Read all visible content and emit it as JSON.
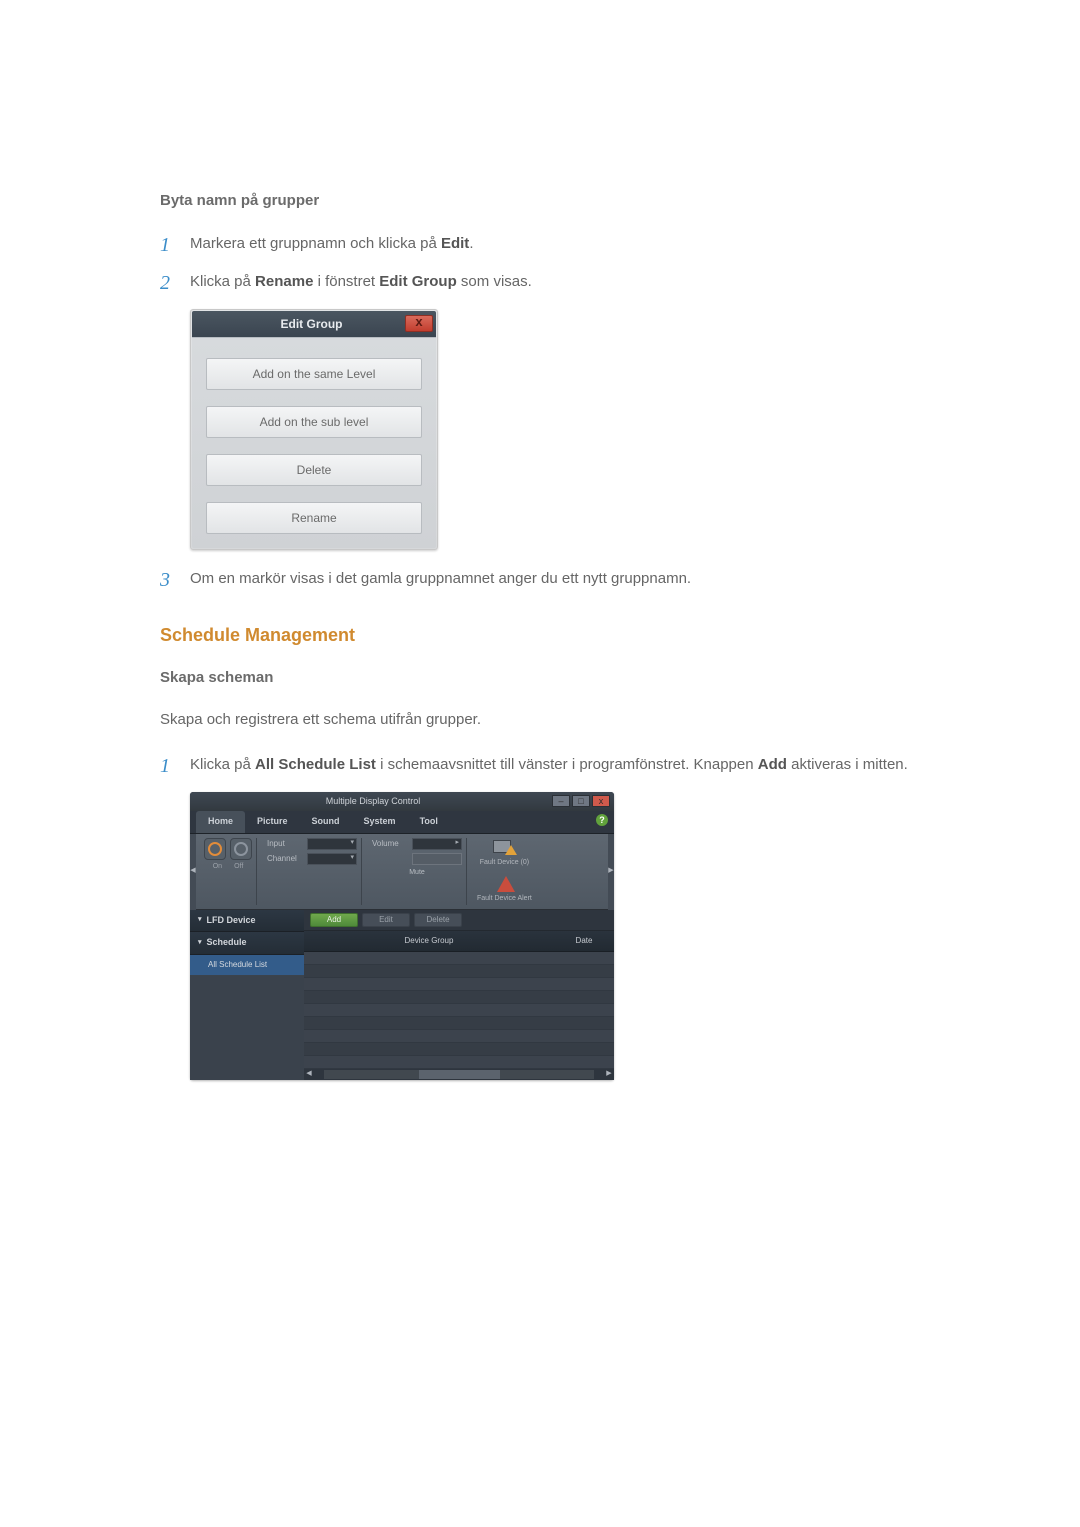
{
  "sub1_title": "Byta namn på grupper",
  "steps1": {
    "s1": {
      "pre": "Markera ett gruppnamn och klicka på ",
      "b1": "Edit",
      "post": "."
    },
    "s2": {
      "pre": "Klicka på ",
      "b1": "Rename",
      "mid": " i fönstret ",
      "b2": "Edit Group",
      "post": " som visas."
    }
  },
  "dialog": {
    "title": "Edit Group",
    "close": "x",
    "buttons": {
      "same": "Add on the same Level",
      "sub": "Add on the sub level",
      "delete": "Delete",
      "rename": "Rename"
    }
  },
  "steps1b": {
    "s3": "Om en markör visas i det gamla gruppnamnet anger du ett nytt gruppnamn."
  },
  "section2_title": "Schedule Management",
  "sub2_title": "Skapa scheman",
  "para2": "Skapa och registrera ett schema utifrån grupper.",
  "steps2": {
    "s1": {
      "pre": "Klicka på ",
      "b1": "All Schedule List",
      "mid": " i schemaavsnittet till vänster i programfönstret. Knappen ",
      "b2": "Add",
      "post": " aktiveras i mitten."
    }
  },
  "app": {
    "title": "Multiple Display Control",
    "tabs": {
      "home": "Home",
      "picture": "Picture",
      "sound": "Sound",
      "system": "System",
      "tool": "Tool"
    },
    "help": "?",
    "ribbon": {
      "on": "On",
      "off": "Off",
      "input": "Input",
      "channel": "Channel",
      "volume": "Volume",
      "mute": "Mute",
      "fault_info": "Fault Device (0)",
      "fault_alert": "Fault Device Alert"
    },
    "sidebar": {
      "lfd": "LFD Device",
      "schedule": "Schedule",
      "all_list": "All Schedule List"
    },
    "toolbar": {
      "add": "Add",
      "edit": "Edit",
      "delete": "Delete"
    },
    "columns": {
      "group": "Device Group",
      "date": "Date"
    }
  }
}
